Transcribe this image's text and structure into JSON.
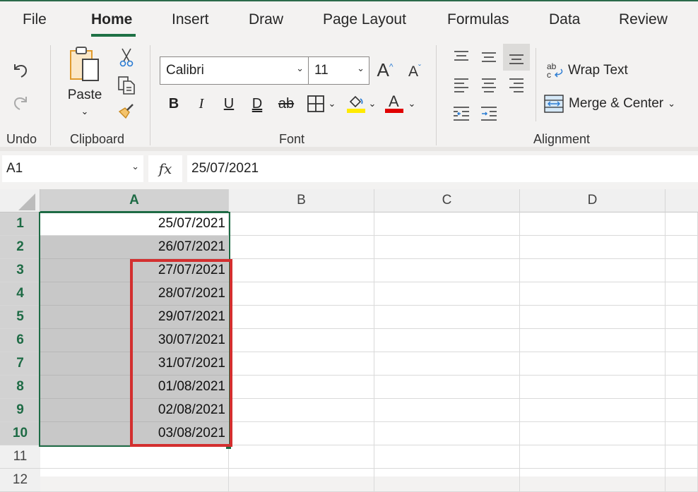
{
  "tabs": [
    {
      "label": "File",
      "active": false
    },
    {
      "label": "Home",
      "active": true
    },
    {
      "label": "Insert",
      "active": false
    },
    {
      "label": "Draw",
      "active": false
    },
    {
      "label": "Page Layout",
      "active": false
    },
    {
      "label": "Formulas",
      "active": false
    },
    {
      "label": "Data",
      "active": false
    },
    {
      "label": "Review",
      "active": false
    }
  ],
  "ribbon": {
    "undo": {
      "group_label": "Undo",
      "undo_icon": "undo-icon",
      "redo_icon": "redo-icon"
    },
    "clipboard": {
      "group_label": "Clipboard",
      "paste_label": "Paste",
      "icons": [
        "paste-icon",
        "cut-icon",
        "copy-icon",
        "format-painter-icon"
      ]
    },
    "font": {
      "group_label": "Font",
      "font_name": "Calibri",
      "font_size": "11",
      "buttons": [
        "B",
        "I",
        "U",
        "D",
        "ab"
      ],
      "fill_color": "#ffea00",
      "font_color": "#e00000"
    },
    "alignment": {
      "group_label": "Alignment",
      "wrap_text_label": "Wrap Text",
      "merge_center_label": "Merge & Center"
    }
  },
  "formula_bar": {
    "name_box": "A1",
    "fx_label": "fx",
    "content": "25/07/2021"
  },
  "sheet": {
    "columns": [
      "A",
      "B",
      "C",
      "D"
    ],
    "rows": [
      "1",
      "2",
      "3",
      "4",
      "5",
      "6",
      "7",
      "8",
      "9",
      "10",
      "11",
      "12"
    ],
    "colA_values": [
      "25/07/2021",
      "26/07/2021",
      "27/07/2021",
      "28/07/2021",
      "29/07/2021",
      "30/07/2021",
      "31/07/2021",
      "01/08/2021",
      "02/08/2021",
      "03/08/2021"
    ],
    "selection": "A1:A10",
    "highlight_range": "A3:A10",
    "accent_green": "#1e6b45",
    "highlight_red": "#d32f2f"
  }
}
